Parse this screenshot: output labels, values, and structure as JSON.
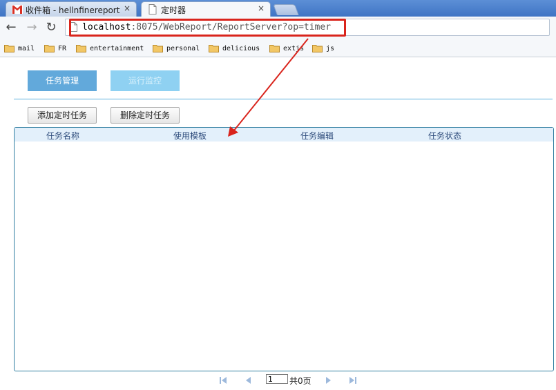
{
  "browser": {
    "tabs": [
      {
        "title": "收件箱 - hellnfinereport",
        "close": "×",
        "icon": "gmail-icon"
      },
      {
        "title": "定时器",
        "close": "×",
        "icon": "page-icon"
      }
    ],
    "url_host": "localhost",
    "url_path": ":8075/WebReport/ReportServer?op=timer",
    "bookmarks": [
      "mail",
      "FR",
      "entertainment",
      "personal",
      "delicious",
      "extjs",
      "js"
    ]
  },
  "page": {
    "tabs": {
      "task_management": "任务管理",
      "run_monitor": "运行监控"
    },
    "actions": {
      "add": "添加定时任务",
      "delete": "删除定时任务"
    },
    "grid": {
      "columns": [
        "任务名称",
        "使用模板",
        "任务编辑",
        "任务状态"
      ],
      "rows": []
    },
    "pager": {
      "current_page": "1",
      "total": "共0页"
    }
  },
  "colors": {
    "accent": "#62a9db",
    "annotation": "#d9241c",
    "grid_border": "#2e7da0"
  }
}
